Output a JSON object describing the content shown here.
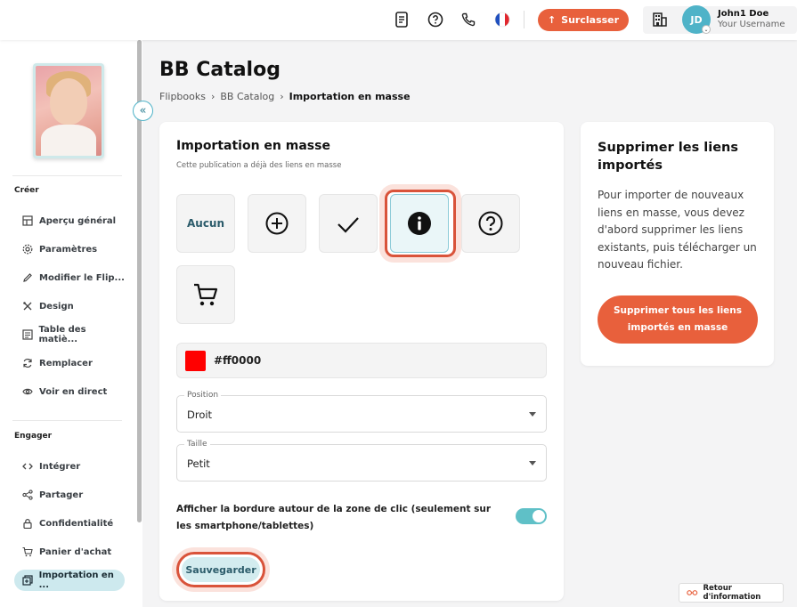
{
  "topbar": {
    "upgrade_label": "Surclasser",
    "avatar_initials": "JD",
    "user_name": "John1 Doe",
    "user_subtitle": "Your Username",
    "language": "fr"
  },
  "sidebar": {
    "section_create": "Créer",
    "section_engage": "Engager",
    "items_create": [
      {
        "label": "Aperçu général",
        "icon": "grid-icon"
      },
      {
        "label": "Paramètres",
        "icon": "settings-icon"
      },
      {
        "label": "Modifier le Flip...",
        "icon": "pencil-icon"
      },
      {
        "label": "Design",
        "icon": "design-tools-icon"
      },
      {
        "label": "Table des matiè...",
        "icon": "table-of-contents-icon"
      },
      {
        "label": "Remplacer",
        "icon": "refresh-icon"
      },
      {
        "label": "Voir en direct",
        "icon": "eye-icon"
      }
    ],
    "items_engage": [
      {
        "label": "Intégrer",
        "icon": "code-icon"
      },
      {
        "label": "Partager",
        "icon": "share-icon"
      },
      {
        "label": "Confidentialité",
        "icon": "lock-icon"
      },
      {
        "label": "Panier d'achat",
        "icon": "cart-icon"
      },
      {
        "label": "Importation en ...",
        "icon": "import-icon",
        "active": true
      }
    ]
  },
  "main": {
    "title": "BB Catalog",
    "breadcrumb": [
      "Flipbooks",
      "BB Catalog",
      "Importation en masse"
    ]
  },
  "import_card": {
    "title": "Importation en masse",
    "subtitle": "Cette publication a déjà des liens en masse",
    "icon_options": [
      {
        "name": "none",
        "label": "Aucun"
      },
      {
        "name": "plus-circle-icon"
      },
      {
        "name": "check-icon"
      },
      {
        "name": "info-icon",
        "selected": true
      },
      {
        "name": "question-icon"
      },
      {
        "name": "cart-icon"
      }
    ],
    "color_value": "#ff0000",
    "position": {
      "label": "Position",
      "value": "Droit"
    },
    "size": {
      "label": "Taille",
      "value": "Petit"
    },
    "border_toggle_label": "Afficher la bordure autour de la zone de clic (seulement sur les smartphone/tablettes)",
    "border_toggle_on": true,
    "save_label": "Sauvegarder"
  },
  "delete_card": {
    "title": "Supprimer les liens importés",
    "text": "Pour importer de nouveaux liens en masse, vous devez d'abord supprimer les liens existants, puis télécharger un nouveau fichier.",
    "button_label": "Supprimer tous les liens importés en masse"
  },
  "feedback_label": "Retour d'information",
  "colors": {
    "accent": "#e8603c",
    "teal": "#4fb3c8",
    "toggle": "#5fc0c7",
    "active_bg": "#cde9ee"
  }
}
